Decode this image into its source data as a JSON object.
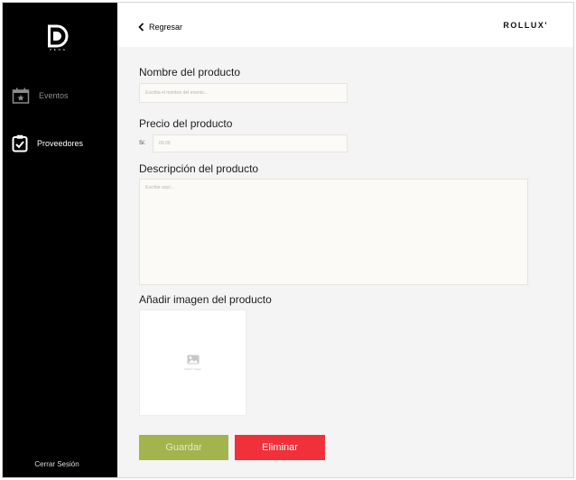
{
  "sidebar": {
    "logo_subtitle": "P E N G",
    "items": [
      {
        "label": "Eventos",
        "icon": "calendar-star-icon"
      },
      {
        "label": "Proveedores",
        "icon": "clipboard-check-icon"
      }
    ],
    "logout_label": "Cerrar Sesión"
  },
  "header": {
    "back_label": "Regresar",
    "brand": "ROLLUX'"
  },
  "form": {
    "name_label": "Nombre del producto",
    "name_placeholder": "Escriba el nombre del evento...",
    "price_label": "Precio del producto",
    "price_prefix": "S/.",
    "price_placeholder": "00.00",
    "description_label": "Descripción del producto",
    "description_placeholder": "Escribe aquí...",
    "image_label": "Añadir imagen del producto",
    "image_upload_text": "Añadir imagen",
    "save_label": "Guardar",
    "delete_label": "Eliminar"
  },
  "colors": {
    "sidebar_bg": "#000000",
    "save_button": "#a3b34e",
    "delete_button": "#f0303a",
    "content_bg": "#f4f4f4"
  }
}
